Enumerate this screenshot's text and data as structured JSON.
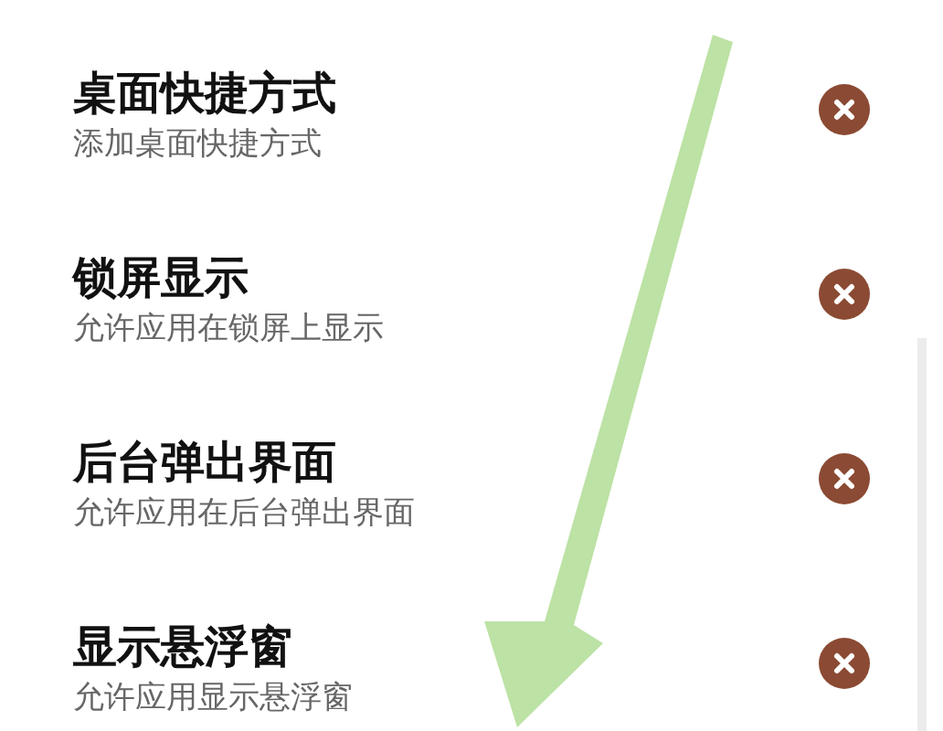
{
  "permissions": [
    {
      "title": "桌面快捷方式",
      "description": "添加桌面快捷方式",
      "allowed": false
    },
    {
      "title": "锁屏显示",
      "description": "允许应用在锁屏上显示",
      "allowed": false
    },
    {
      "title": "后台弹出界面",
      "description": "允许应用在后台弹出界面",
      "allowed": false
    },
    {
      "title": "显示悬浮窗",
      "description": "允许应用显示悬浮窗",
      "allowed": false
    }
  ]
}
